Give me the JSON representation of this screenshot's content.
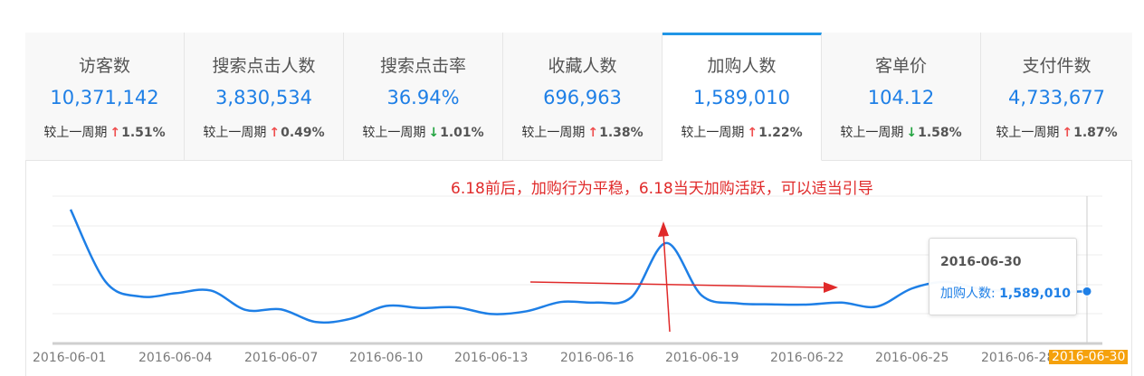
{
  "metrics": [
    {
      "title": "访客数",
      "value": "10,371,142",
      "compare_label": "较上一周期",
      "direction": "up",
      "change": "1.51%"
    },
    {
      "title": "搜索点击人数",
      "value": "3,830,534",
      "compare_label": "较上一周期",
      "direction": "up",
      "change": "0.49%"
    },
    {
      "title": "搜索点击率",
      "value": "36.94%",
      "compare_label": "较上一周期",
      "direction": "down",
      "change": "1.01%"
    },
    {
      "title": "收藏人数",
      "value": "696,963",
      "compare_label": "较上一周期",
      "direction": "up",
      "change": "1.38%"
    },
    {
      "title": "加购人数",
      "value": "1,589,010",
      "compare_label": "较上一周期",
      "direction": "up",
      "change": "1.22%",
      "active": true
    },
    {
      "title": "客单价",
      "value": "104.12",
      "compare_label": "较上一周期",
      "direction": "down",
      "change": "1.58%"
    },
    {
      "title": "支付件数",
      "value": "4,733,677",
      "compare_label": "较上一周期",
      "direction": "up",
      "change": "1.87%"
    }
  ],
  "arrows": {
    "up": "↑",
    "down": "↓"
  },
  "annotation": "6.18前后，加购行为平稳，6.18当天加购活跃，可以适当引导",
  "tooltip": {
    "date": "2016-06-30",
    "series_label": "加购人数:",
    "value": "1,589,010"
  },
  "chart_data": {
    "type": "line",
    "series": [
      {
        "name": "加购人数",
        "color": "#1e7fe6",
        "values": [
          [
            "2016-06-01",
            2200000
          ],
          [
            "2016-06-02",
            1660000
          ],
          [
            "2016-06-03",
            1550000
          ],
          [
            "2016-06-04",
            1575000
          ],
          [
            "2016-06-05",
            1595000
          ],
          [
            "2016-06-06",
            1450000
          ],
          [
            "2016-06-07",
            1455000
          ],
          [
            "2016-06-08",
            1360000
          ],
          [
            "2016-06-09",
            1385000
          ],
          [
            "2016-06-10",
            1480000
          ],
          [
            "2016-06-11",
            1465000
          ],
          [
            "2016-06-12",
            1470000
          ],
          [
            "2016-06-13",
            1420000
          ],
          [
            "2016-06-14",
            1440000
          ],
          [
            "2016-06-15",
            1510000
          ],
          [
            "2016-06-16",
            1505000
          ],
          [
            "2016-06-17",
            1545000
          ],
          [
            "2016-06-18",
            1950000
          ],
          [
            "2016-06-19",
            1560000
          ],
          [
            "2016-06-20",
            1500000
          ],
          [
            "2016-06-21",
            1492000
          ],
          [
            "2016-06-22",
            1490000
          ],
          [
            "2016-06-23",
            1505000
          ],
          [
            "2016-06-24",
            1475000
          ],
          [
            "2016-06-25",
            1610000
          ],
          [
            "2016-06-26",
            1660000
          ],
          [
            "2016-06-27",
            1605000
          ],
          [
            "2016-06-28",
            1590000
          ],
          [
            "2016-06-29",
            1585000
          ],
          [
            "2016-06-30",
            1589010
          ]
        ]
      }
    ],
    "x_tick_labels": [
      "2016-06-01",
      "2016-06-04",
      "2016-06-07",
      "2016-06-10",
      "2016-06-13",
      "2016-06-16",
      "2016-06-19",
      "2016-06-22",
      "2016-06-25",
      "2016-06-28",
      "2016-06-30"
    ],
    "highlight_x": "2016-06-30",
    "ylim": [
      1200000,
      2300000
    ],
    "grid": true
  }
}
